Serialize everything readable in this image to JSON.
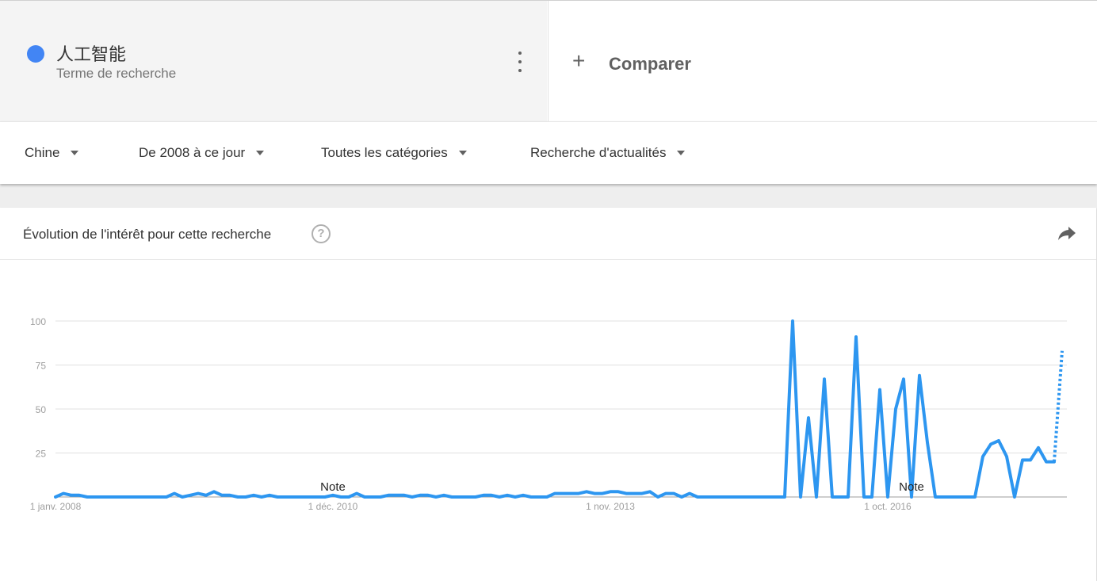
{
  "term": {
    "name": "人工智能",
    "type": "Terme de recherche",
    "color": "#4285f4",
    "menu_icon": "more-vert-icon"
  },
  "compare": {
    "icon": "+",
    "label": "Comparer"
  },
  "filters": {
    "region": "Chine",
    "period": "De 2008 à ce jour",
    "category": "Toutes les catégories",
    "search_type": "Recherche d'actualités"
  },
  "card": {
    "title": "Évolution de l'intérêt pour cette recherche",
    "help_icon": "?",
    "share_icon": "share-icon"
  },
  "chart_data": {
    "type": "line",
    "x_start": "2008-01",
    "x_step": "1 month",
    "x_tick_labels": [
      "1 janv. 2008",
      "1 déc. 2010",
      "1 nov. 2013",
      "1 oct. 2016"
    ],
    "x_tick_months": [
      "2008-01",
      "2010-12",
      "2013-11",
      "2016-10"
    ],
    "ylim": [
      0,
      100
    ],
    "y_ticks": [
      100,
      75,
      50,
      25
    ],
    "grid": true,
    "series": [
      {
        "name": "人工智能",
        "color": "#2d96f0",
        "partial_last_point": true,
        "values": [
          0,
          2,
          1,
          1,
          0,
          0,
          0,
          0,
          0,
          0,
          0,
          0,
          0,
          0,
          0,
          2,
          0,
          1,
          2,
          1,
          3,
          1,
          1,
          0,
          0,
          1,
          0,
          1,
          0,
          0,
          0,
          0,
          0,
          0,
          0,
          1,
          0,
          0,
          2,
          0,
          0,
          0,
          1,
          1,
          1,
          0,
          1,
          1,
          0,
          1,
          0,
          0,
          0,
          0,
          1,
          1,
          0,
          1,
          0,
          1,
          0,
          0,
          0,
          2,
          2,
          2,
          2,
          3,
          2,
          2,
          3,
          3,
          2,
          2,
          2,
          3,
          0,
          2,
          2,
          0,
          2,
          0,
          0,
          0,
          0,
          0,
          0,
          0,
          0,
          0,
          0,
          0,
          0,
          100,
          0,
          45,
          0,
          67,
          0,
          0,
          0,
          91,
          0,
          0,
          61,
          0,
          50,
          67,
          0,
          69,
          31,
          0,
          0,
          0,
          0,
          0,
          0,
          23,
          30,
          32,
          23,
          0,
          21,
          21,
          28,
          20,
          20,
          83
        ]
      }
    ],
    "annotations": [
      {
        "label": "Note",
        "month": "2010-12"
      },
      {
        "label": "Note",
        "month": "2017-01"
      }
    ]
  }
}
